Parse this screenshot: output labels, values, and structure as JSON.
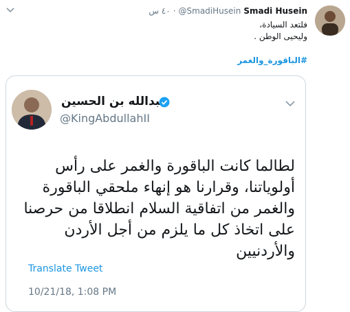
{
  "tweet": {
    "author_name": "Smadi Husein",
    "author_handle": "@SmadiHusein",
    "separator": "·",
    "time": "٤٠ س",
    "text_line1": "فلتعد السيادة،",
    "text_line2": "وليحيى الوطن .",
    "hashtag": "#الباقورة_والغمر"
  },
  "quoted_tweet": {
    "author_name": "عبدالله بن الحسين",
    "author_handle": "@KingAbdullahII",
    "text": "لطالما كانت الباقورة والغمر على رأس أولوياتنا، وقرارنا هو إنهاء ملحقي الباقورة والغمر من اتفاقية السلام انطلاقا من حرصنا على اتخاذ كل ما يلزم من أجل الأردن والأردنيين",
    "translate_label": "Translate Tweet",
    "timestamp": "10/21/18, 1:08 PM"
  },
  "colors": {
    "link": "#1b95e0",
    "muted": "#657786",
    "border": "#ccd6dd",
    "verified": "#1da1f2"
  }
}
